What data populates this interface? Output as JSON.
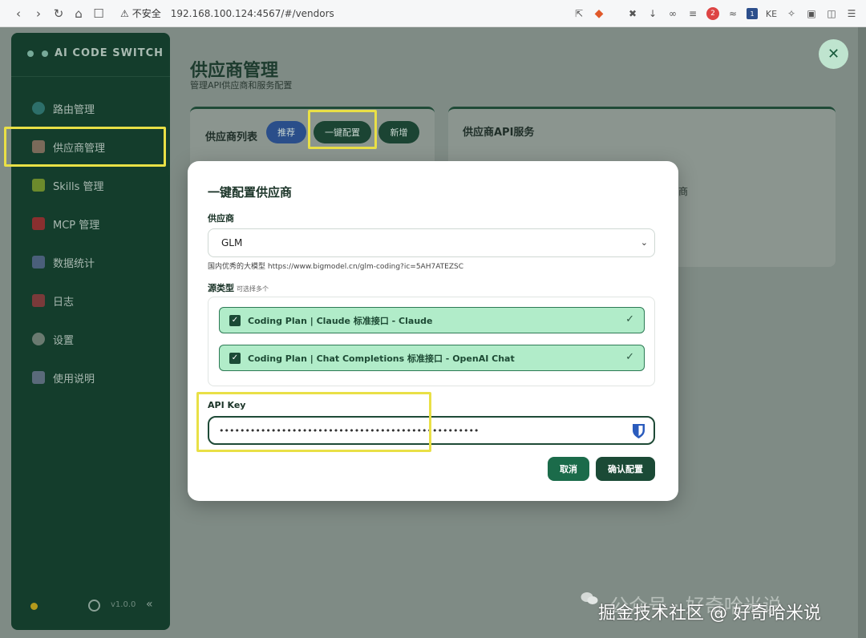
{
  "browser": {
    "insecure_label": "不安全",
    "url": "192.168.100.124:4567/#/vendors",
    "ext_ke": "KE"
  },
  "sidebar": {
    "brand": "AI CODE SWITCH",
    "items": [
      {
        "label": "路由管理",
        "icon": "globe-icon",
        "color": "#2d6f6a"
      },
      {
        "label": "供应商管理",
        "icon": "factory-icon",
        "color": "#7a6a5a"
      },
      {
        "label": "Skills 管理",
        "icon": "puzzle-icon",
        "color": "#6c8a2c"
      },
      {
        "label": "MCP 管理",
        "icon": "plug-icon",
        "color": "#8a2f2f"
      },
      {
        "label": "数据统计",
        "icon": "chart-icon",
        "color": "#4a5f7a"
      },
      {
        "label": "日志",
        "icon": "log-icon",
        "color": "#7a3a3a"
      },
      {
        "label": "设置",
        "icon": "gear-icon",
        "color": "#6a7a70"
      },
      {
        "label": "使用说明",
        "icon": "book-icon",
        "color": "#5a6a7a"
      }
    ],
    "version": "v1.0.0",
    "collapse": "«"
  },
  "page": {
    "title": "供应商管理",
    "subtitle": "管理API供应商和服务配置",
    "vendor_list_title": "供应商列表",
    "btn_recommend": "推荐",
    "btn_oneclick": "一键配置",
    "btn_add": "新增",
    "api_service_title": "供应商API服务",
    "partial_char": "商"
  },
  "modal": {
    "title": "一键配置供应商",
    "vendor_label": "供应商",
    "vendor_value": "GLM",
    "vendor_hint": "国内优秀的大模型 https://www.bigmodel.cn/glm-coding?ic=5AH7ATEZSC",
    "source_label": "源类型",
    "source_hint": "可选择多个",
    "sources": [
      {
        "label": "Coding Plan | Claude 标准接口 - Claude",
        "checked": true
      },
      {
        "label": "Coding Plan | Chat Completions 标准接口 - OpenAI Chat",
        "checked": true
      }
    ],
    "apikey_label": "API Key",
    "apikey_value": "••••••••••••••••••••••••••••••••••••••••••••••••••",
    "btn_cancel": "取消",
    "btn_confirm": "确认配置"
  },
  "watermark": {
    "faint": "公众号 · 好奇哈米说",
    "text": "掘金技术社区 @ 好奇哈米说"
  },
  "colors": {
    "accent": "#1b4a36",
    "highlight": "#e9e046",
    "checked_bg": "#b1ecc9"
  }
}
